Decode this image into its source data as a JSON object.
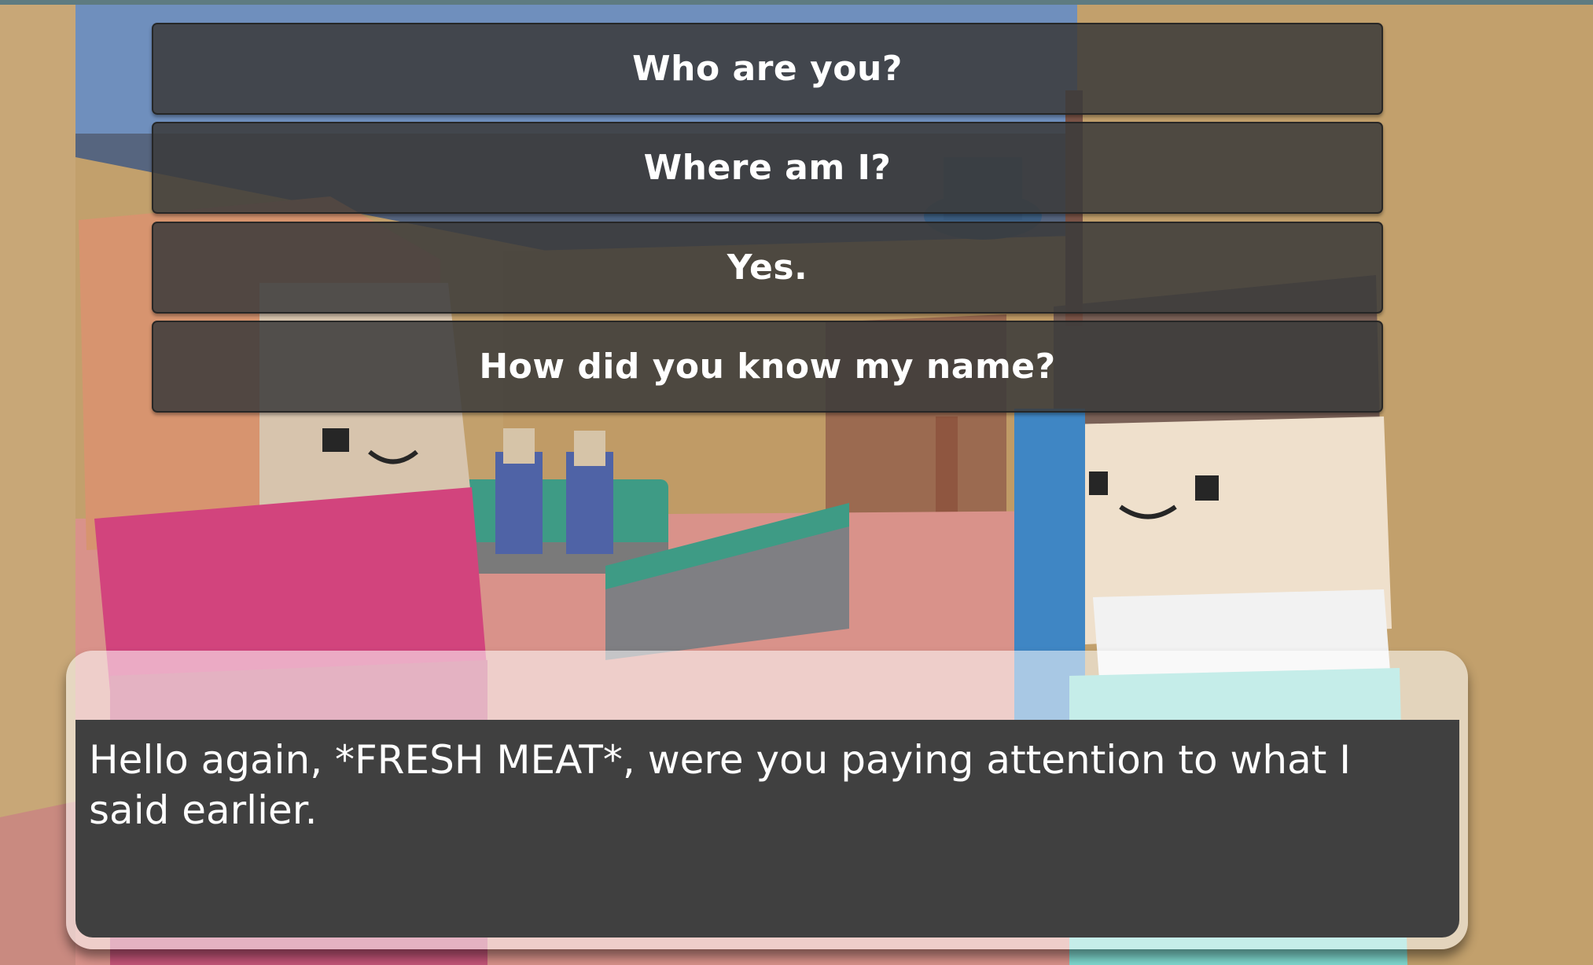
{
  "choices": [
    {
      "label": "Who are you?"
    },
    {
      "label": "Where am I?"
    },
    {
      "label": "Yes."
    },
    {
      "label": "How did you know my name?"
    }
  ],
  "dialog": {
    "text": "Hello again, *FRESH MEAT*, were you paying attention to what I said earlier."
  },
  "colors": {
    "choice_bg": "#3a3a3a",
    "dialog_bg": "#404040",
    "text": "#ffffff"
  }
}
